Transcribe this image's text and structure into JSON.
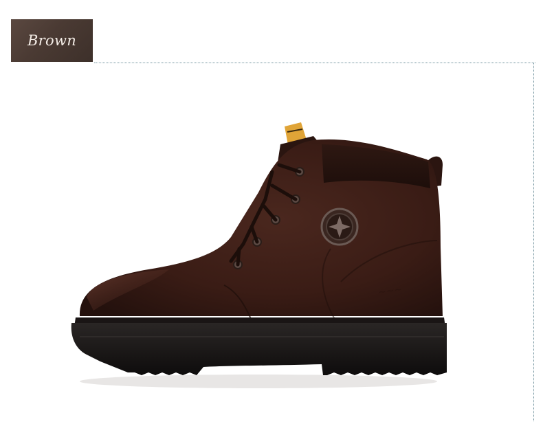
{
  "color_tag": {
    "label": "Brown",
    "background": "#4a3a33",
    "text_color": "#f3ece6"
  },
  "guide_color": "#6d8f9a",
  "product": {
    "icon": "leather-ankle-boot",
    "upper_color": "#3b1d16",
    "sole_color": "#141211",
    "tab_color": "#e0a437"
  }
}
